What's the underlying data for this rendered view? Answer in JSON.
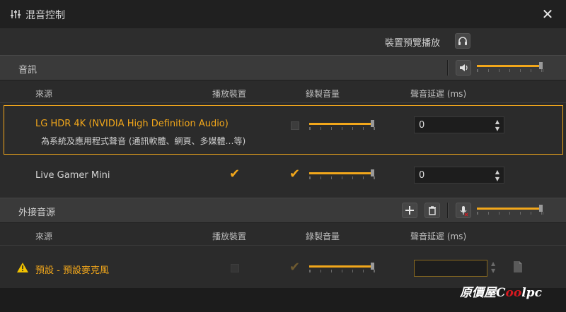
{
  "window": {
    "title": "混音控制"
  },
  "device_preview": {
    "label": "裝置預覽播放"
  },
  "audio_section": {
    "title": "音訊",
    "volume": 0.97
  },
  "columns": {
    "source": "來源",
    "playback": "播放裝置",
    "record": "錄製音量",
    "delay": "聲音延遲 (ms)"
  },
  "audio_sources": [
    {
      "name": "LG HDR 4K (NVIDIA High Definition Audio)",
      "subtitle": "為系統及應用程式聲音 (通訊軟體、網頁、多媒體…等)",
      "playback": false,
      "record_checked": false,
      "record_volume": 0.97,
      "delay": "0"
    },
    {
      "name": "Live Gamer Mini",
      "playback": true,
      "record_checked": true,
      "record_volume": 0.97,
      "delay": "0"
    }
  ],
  "external_section": {
    "title": "外接音源",
    "volume": 0.97
  },
  "external_sources": [
    {
      "name": "預設 - 預設麥克風",
      "playback": false,
      "record_checked": true,
      "record_volume": 0.97,
      "delay": ""
    }
  ],
  "brand": {
    "prefix": "原價屋",
    "c": "C",
    "ring": "oo",
    "suffix": "lpc"
  },
  "colors": {
    "accent": "#f2a71b",
    "warning": "#f2c200"
  }
}
